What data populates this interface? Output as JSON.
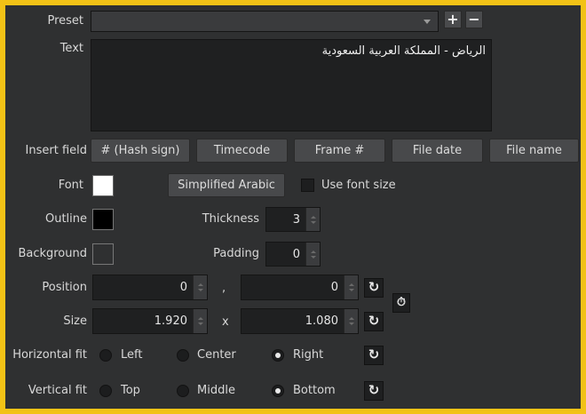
{
  "labels": {
    "preset": "Preset",
    "text": "Text",
    "insert_field": "Insert field",
    "font": "Font",
    "outline": "Outline",
    "background": "Background",
    "thickness": "Thickness",
    "padding": "Padding",
    "position": "Position",
    "size": "Size",
    "horizontal_fit": "Horizontal fit",
    "vertical_fit": "Vertical fit",
    "comma": ",",
    "times": "x"
  },
  "preset": {
    "value": "",
    "add": "+",
    "remove": "−"
  },
  "text_value": "الرياض - المملكة العربية السعودية",
  "insert_buttons": [
    "# (Hash sign)",
    "Timecode",
    "Frame #",
    "File date",
    "File name"
  ],
  "font": {
    "name": "Simplified Arabic",
    "use_font_size": "Use font size",
    "color": "#ffffff",
    "use_font_size_checked": false
  },
  "outline": {
    "color": "#000000",
    "thickness": "3"
  },
  "background": {
    "color": "#2f3031",
    "padding": "0"
  },
  "position": {
    "x": "0",
    "y": "0"
  },
  "size": {
    "w": "1.920",
    "h": "1.080"
  },
  "horizontal_fit": {
    "options": [
      "Left",
      "Center",
      "Right"
    ],
    "selected": "Right"
  },
  "vertical_fit": {
    "options": [
      "Top",
      "Middle",
      "Bottom"
    ],
    "selected": "Bottom"
  },
  "icons": {
    "reset": "reset-icon",
    "timer": "stopwatch-icon"
  }
}
